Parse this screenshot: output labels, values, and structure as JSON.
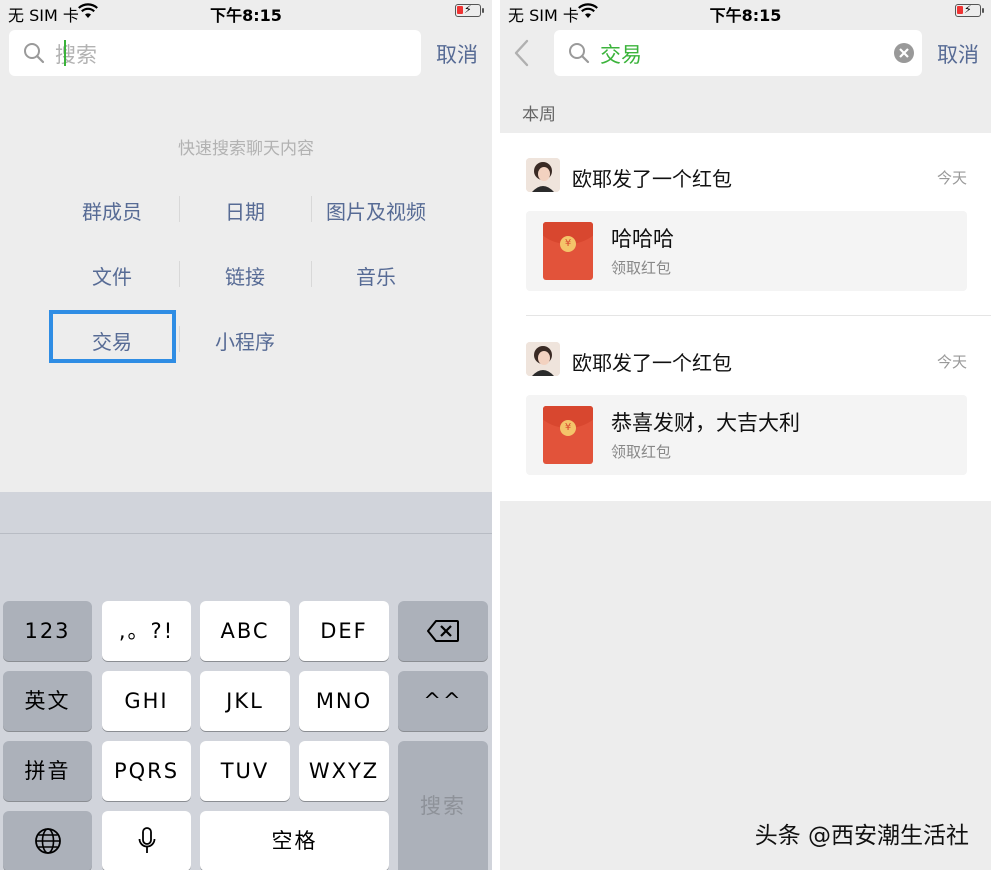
{
  "left": {
    "status": {
      "carrier": "无 SIM 卡",
      "time": "下午8:15"
    },
    "search": {
      "placeholder": "搜索",
      "cancel": "取消"
    },
    "hint": "快速搜索聊天内容",
    "categories": [
      "群成员",
      "日期",
      "图片及视频",
      "文件",
      "链接",
      "音乐",
      "交易",
      "小程序"
    ],
    "keyboard": {
      "keys": [
        "123",
        ",。?!",
        "ABC",
        "DEF",
        "英文",
        "GHI",
        "JKL",
        "MNO",
        "^^",
        "拼音",
        "PQRS",
        "TUV",
        "WXYZ",
        "搜索",
        "空格"
      ],
      "icons": [
        "delete-icon",
        "globe-icon",
        "microphone-icon"
      ]
    }
  },
  "right": {
    "status": {
      "carrier": "无 SIM 卡",
      "time": "下午8:15"
    },
    "search": {
      "query": "交易",
      "cancel": "取消"
    },
    "section": "本周",
    "results": [
      {
        "sender_line": "欧耶发了一个红包",
        "date": "今天",
        "message": "哈哈哈",
        "action": "领取红包"
      },
      {
        "sender_line": "欧耶发了一个红包",
        "date": "今天",
        "message": "恭喜发财，大吉大利",
        "action": "领取红包"
      }
    ]
  },
  "watermark": "头条 @西安潮生活社",
  "colors": {
    "accent_green": "#3bb33b",
    "link_blue": "#576b95",
    "highlight_blue": "#2f8de4",
    "red_packet": "#e2533a"
  }
}
